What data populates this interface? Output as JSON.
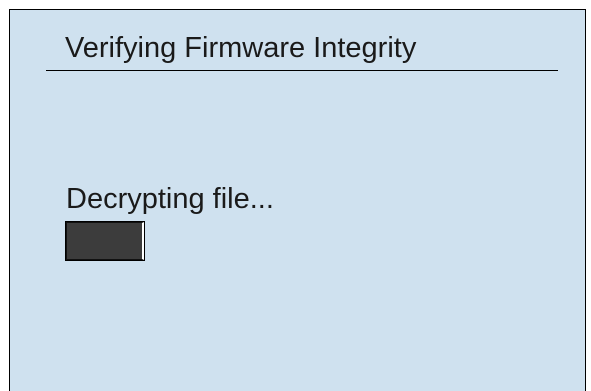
{
  "window": {
    "title": "Verifying Firmware Integrity",
    "background_color": "#cfe1ef"
  },
  "status": {
    "text": "Decrypting file..."
  },
  "progress": {
    "fraction": 1.0,
    "fill_color": "#3c3c3c"
  }
}
